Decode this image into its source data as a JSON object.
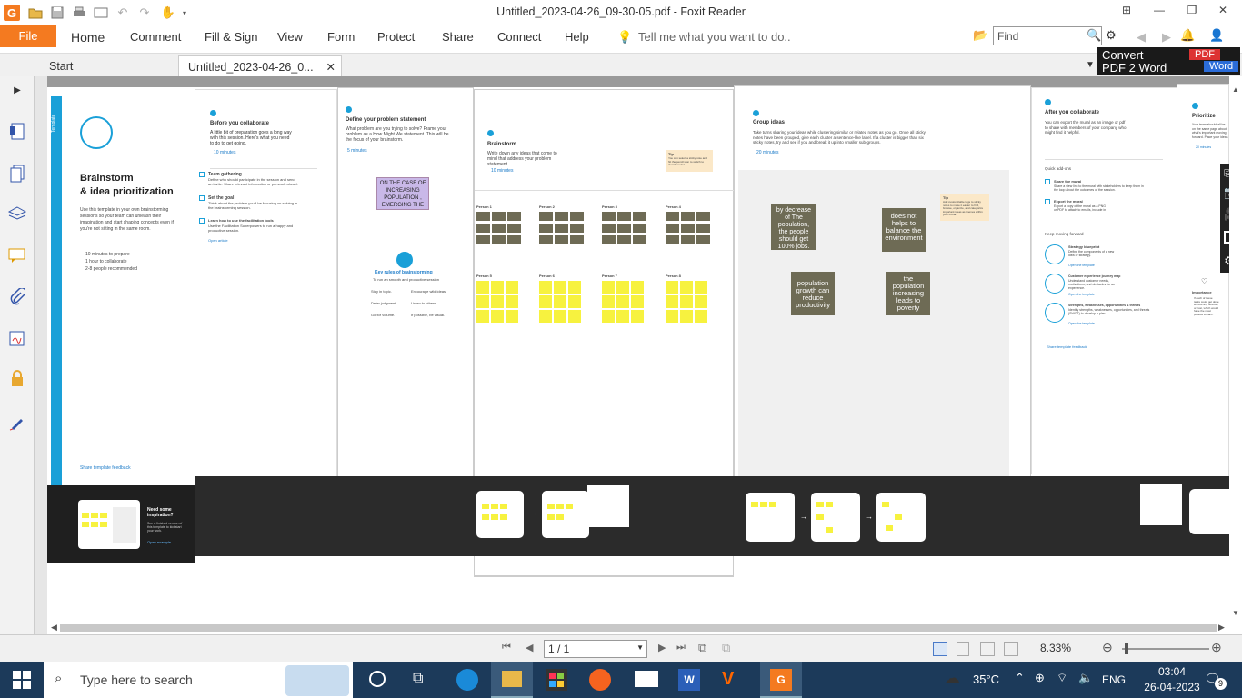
{
  "window": {
    "title": "Untitled_2023-04-26_09-30-05.pdf - Foxit Reader"
  },
  "ribbon": {
    "file": "File",
    "menus": [
      "Home",
      "Comment",
      "Fill & Sign",
      "View",
      "Form",
      "Protect",
      "Share",
      "Connect",
      "Help"
    ],
    "tell_me": "Tell me what you want to do..",
    "find_placeholder": "Find"
  },
  "tabs": {
    "start": "Start",
    "doc": "Untitled_2023-04-26_0..."
  },
  "convert": {
    "line1": "Convert",
    "line2": "PDF 2 Word",
    "pdf": "PDF",
    "word": "Word"
  },
  "pages": {
    "p1": {
      "tag": "Template",
      "title1": "Brainstorm",
      "title2": "& idea prioritization",
      "desc": "Use this template in your own brainstorming sessions so your team can unleash their imagination and start shaping concepts even if you're not sitting in the same room.",
      "items": [
        "10 minutes to prepare",
        "1 hour to collaborate",
        "2-8 people recommended"
      ],
      "share": "Share template feedback",
      "need": "Need some inspiration?",
      "need_sub": "See a finished version of this template to kickstart your work.",
      "open": "Open example"
    },
    "p2": {
      "num": "1",
      "title": "Before you collaborate",
      "desc": "A little bit of preparation goes a long way with this session. Here's what you need to do to get going.",
      "time": "10 minutes",
      "a_title": "Team gathering",
      "a_desc": "Define who should participate in the session and send an invite. Share relevant information or pre-work ahead.",
      "b_title": "Set the goal",
      "b_desc": "Think about the problem you'll be focusing on solving in the brainstorming session.",
      "c_title": "Learn how to use the facilitation tools",
      "c_desc": "Use the Facilitation Superpowers to run a happy and productive session.",
      "link": "Open article"
    },
    "p3": {
      "num": "1",
      "title": "Define your problem statement",
      "desc": "What problem are you trying to solve? Frame your problem as a How Might We statement. This will be the focus of your brainstorm.",
      "time": "5 minutes",
      "note": "ON THE CASE OF INCREASING POPULATION , EMERGING THE",
      "rules_title": "Key rules of brainstorming",
      "rules_sub": "To run an smooth and productive session",
      "rules": [
        "Stay in topic.",
        "Encourage wild ideas.",
        "Defer judgment.",
        "Listen to others.",
        "Go for volume.",
        "If possible, be visual."
      ]
    },
    "p4": {
      "num": "2",
      "title": "Brainstorm",
      "desc": "Write down any ideas that come to mind that address your problem statement.",
      "time": "10 minutes",
      "tip": "Tip",
      "tip_desc": "You can select a sticky note and hit the pencil icon to switch to sketch mode!",
      "persons": [
        "Person 1",
        "Person 2",
        "Person 3",
        "Person 4",
        "Person 5",
        "Person 6",
        "Person 7",
        "Person 8"
      ]
    },
    "p5": {
      "num": "3",
      "title": "Group ideas",
      "desc": "Take turns sharing your ideas while clustering similar or related notes as you go. Once all sticky notes have been grouped, give each cluster a sentence-like label. If a cluster is bigger than six sticky notes, try and see if you and break it up into smaller sub-groups.",
      "time": "20 minutes",
      "notes": [
        "by decrease of The population, the people should get 100% jobs.",
        "does not helps to balance the environment",
        "population growth can reduce productivity",
        "the population increasing leads to poverty"
      ],
      "tip": "Tip",
      "tip_desc": "Add customizable tags to sticky notes to make it easier to find, browse, organize, and categorize important ideas as themes within your mural."
    },
    "p6": {
      "num": "4",
      "title": "After you collaborate",
      "desc": "You can export the mural as an image or pdf to share with members of your company who might find it helpful.",
      "addons": "Quick add-ons",
      "a_title": "Share the mural",
      "a_desc": "Share a view link to the mural with stakeholders to keep them in the loop about the outcomes of the session.",
      "b_title": "Export the mural",
      "b_desc": "Export a copy of the mural as a PNG or PDF to attach to emails, include in slides, or save in your drive.",
      "forward": "Keep moving forward",
      "f1": "Strategy blueprint",
      "f1d": "Define the components of a new idea or strategy.",
      "f2": "Customer experience journey map",
      "f2d": "Understand customer needs, motivations, and obstacles for an experience.",
      "f3": "Strengths, weaknesses, opportunities & threats",
      "f3d": "Identify strengths, weaknesses, opportunities, and threats (SWOT) to develop a plan.",
      "open": "Open the template",
      "share": "Share template feedback"
    },
    "p7": {
      "num": "4",
      "title": "Prioritize",
      "desc": "Your team should all be on the same page about what's important moving forward. Place your ideas on this grid to determine which ideas are important and which are feasible.",
      "time": "20 minutes",
      "imp": "Importance",
      "imp_desc": "If each of these tasks could get done without any difficulty or cost, which would have the most positive impact?"
    }
  },
  "status": {
    "page": "1 / 1",
    "zoom": "8.33%"
  },
  "taskbar": {
    "search": "Type here to search",
    "weather": "35°C",
    "lang": "ENG",
    "time": "03:04",
    "date": "26-04-2023",
    "notif": "9"
  }
}
